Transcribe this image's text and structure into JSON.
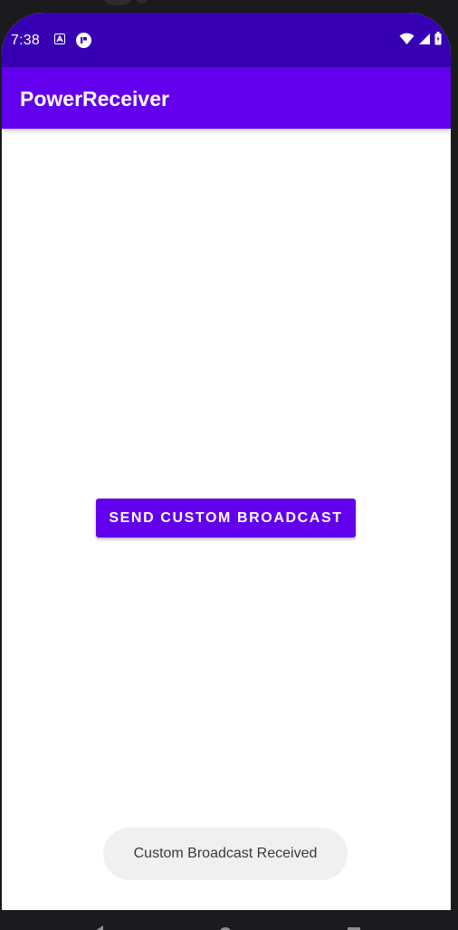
{
  "status_bar": {
    "time": "7:38",
    "notification_icons": [
      "a-box-icon",
      "circle-badge-icon"
    ],
    "system_icons": [
      "wifi-icon",
      "signal-icon",
      "battery-icon"
    ],
    "color": "#3700b3"
  },
  "app_bar": {
    "title": "PowerReceiver",
    "color": "#6200ee"
  },
  "main": {
    "send_button_label": "SEND CUSTOM BROADCAST"
  },
  "toast": {
    "message": "Custom Broadcast Received"
  },
  "nav_bar": {
    "icons": [
      "back-icon",
      "home-icon",
      "recents-icon"
    ]
  }
}
